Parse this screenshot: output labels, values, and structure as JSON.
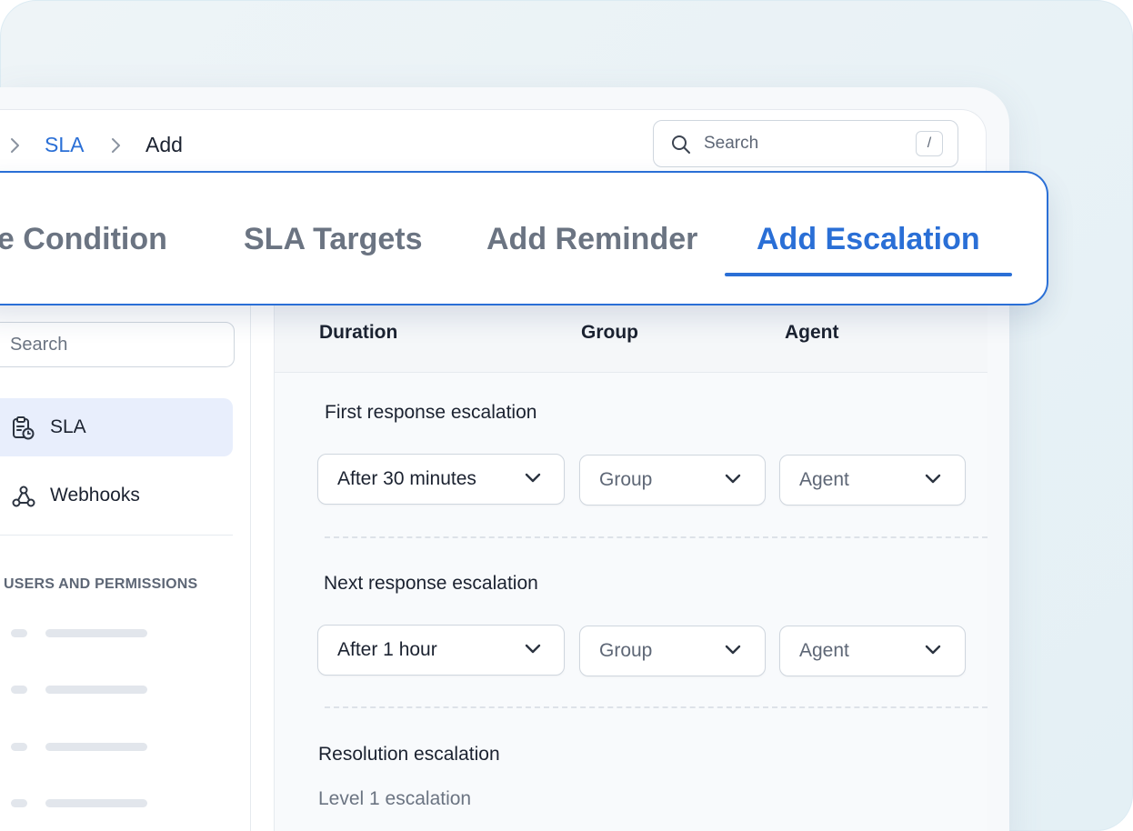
{
  "breadcrumb": {
    "items": [
      "SLA",
      "Add"
    ]
  },
  "search": {
    "placeholder": "Search",
    "shortcut": "/"
  },
  "tabs": [
    {
      "label": "se Condition",
      "active": false
    },
    {
      "label": "SLA Targets",
      "active": false
    },
    {
      "label": "Add Reminder",
      "active": false
    },
    {
      "label": "Add Escalation",
      "active": true
    }
  ],
  "sidebar": {
    "search_placeholder": "Search",
    "items": [
      {
        "label": "SLA",
        "icon": "clipboard-clock-icon",
        "active": true
      },
      {
        "label": "Webhooks",
        "icon": "webhook-icon",
        "active": false
      }
    ],
    "section_title": "USERS AND PERMISSIONS"
  },
  "table": {
    "columns": [
      "Duration",
      "Group",
      "Agent"
    ],
    "rows": [
      {
        "title": "First response escalation",
        "duration": "After 30 minutes",
        "group": "Group",
        "agent": "Agent"
      },
      {
        "title": "Next response escalation",
        "duration": "After 1 hour",
        "group": "Group",
        "agent": "Agent"
      }
    ],
    "resolution": {
      "title": "Resolution escalation",
      "level": "Level 1 escalation"
    }
  },
  "colors": {
    "accent": "#2a6fd6",
    "active_bg": "#e8eefc",
    "text": "#1b2230",
    "muted": "#6b7482"
  }
}
